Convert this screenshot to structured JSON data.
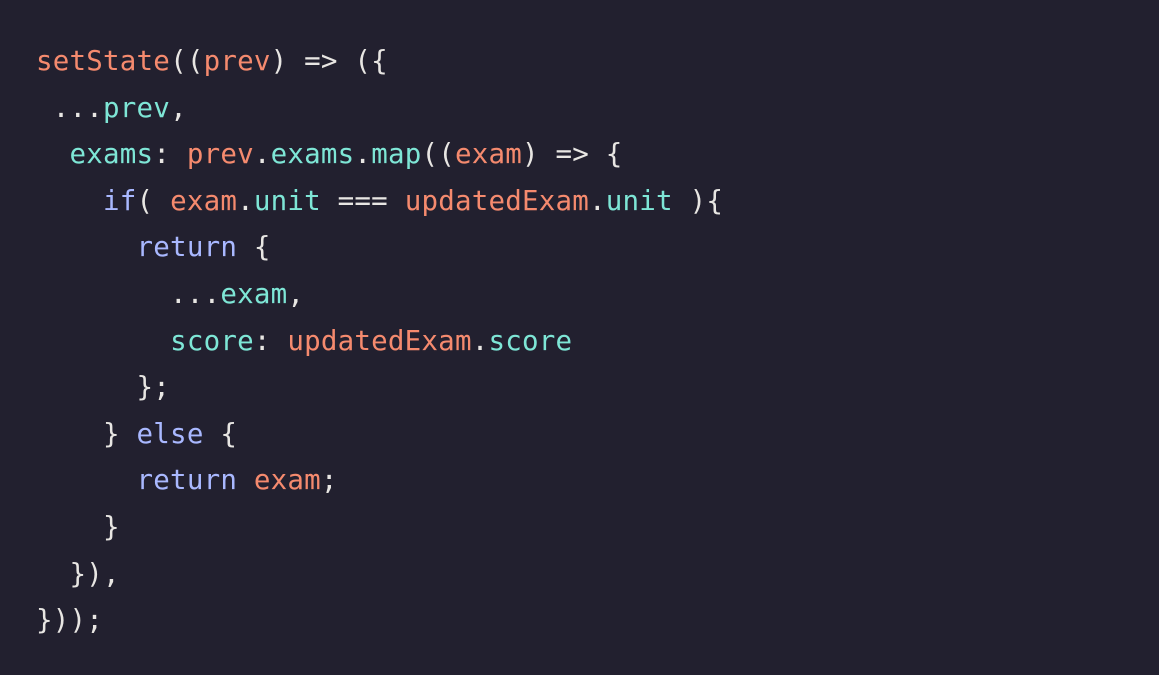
{
  "colors": {
    "background": "#22202f",
    "default": "#e8e6e3",
    "function_and_variable": "#f58a6e",
    "property": "#7ee6d6",
    "keyword": "#a9b8ff"
  },
  "code": {
    "lines": [
      [
        {
          "text": "setState",
          "type": "fn"
        },
        {
          "text": "((",
          "type": "punc"
        },
        {
          "text": "prev",
          "type": "var"
        },
        {
          "text": ") => ({",
          "type": "punc"
        }
      ],
      [
        {
          "text": " ...",
          "type": "punc"
        },
        {
          "text": "prev",
          "type": "prop"
        },
        {
          "text": ",",
          "type": "punc"
        }
      ],
      [
        {
          "text": "  ",
          "type": "punc"
        },
        {
          "text": "exams",
          "type": "prop"
        },
        {
          "text": ": ",
          "type": "punc"
        },
        {
          "text": "prev",
          "type": "var"
        },
        {
          "text": ".",
          "type": "punc"
        },
        {
          "text": "exams",
          "type": "prop"
        },
        {
          "text": ".",
          "type": "punc"
        },
        {
          "text": "map",
          "type": "prop"
        },
        {
          "text": "((",
          "type": "punc"
        },
        {
          "text": "exam",
          "type": "var"
        },
        {
          "text": ") => {",
          "type": "punc"
        }
      ],
      [
        {
          "text": "    ",
          "type": "punc"
        },
        {
          "text": "if",
          "type": "kw"
        },
        {
          "text": "( ",
          "type": "punc"
        },
        {
          "text": "exam",
          "type": "var"
        },
        {
          "text": ".",
          "type": "punc"
        },
        {
          "text": "unit",
          "type": "prop"
        },
        {
          "text": " === ",
          "type": "punc"
        },
        {
          "text": "updatedExam",
          "type": "var"
        },
        {
          "text": ".",
          "type": "punc"
        },
        {
          "text": "unit",
          "type": "prop"
        },
        {
          "text": " ){",
          "type": "punc"
        }
      ],
      [
        {
          "text": "      ",
          "type": "punc"
        },
        {
          "text": "return",
          "type": "kw"
        },
        {
          "text": " {",
          "type": "punc"
        }
      ],
      [
        {
          "text": "        ...",
          "type": "punc"
        },
        {
          "text": "exam",
          "type": "prop"
        },
        {
          "text": ",",
          "type": "punc"
        }
      ],
      [
        {
          "text": "        ",
          "type": "punc"
        },
        {
          "text": "score",
          "type": "prop"
        },
        {
          "text": ": ",
          "type": "punc"
        },
        {
          "text": "updatedExam",
          "type": "var"
        },
        {
          "text": ".",
          "type": "punc"
        },
        {
          "text": "score",
          "type": "prop"
        }
      ],
      [
        {
          "text": "      };",
          "type": "punc"
        }
      ],
      [
        {
          "text": "    } ",
          "type": "punc"
        },
        {
          "text": "else",
          "type": "kw"
        },
        {
          "text": " {",
          "type": "punc"
        }
      ],
      [
        {
          "text": "      ",
          "type": "punc"
        },
        {
          "text": "return",
          "type": "kw"
        },
        {
          "text": " ",
          "type": "punc"
        },
        {
          "text": "exam",
          "type": "var"
        },
        {
          "text": ";",
          "type": "punc"
        }
      ],
      [
        {
          "text": "    }",
          "type": "punc"
        }
      ],
      [
        {
          "text": "  }),",
          "type": "punc"
        }
      ],
      [
        {
          "text": "}));",
          "type": "punc"
        }
      ]
    ]
  }
}
